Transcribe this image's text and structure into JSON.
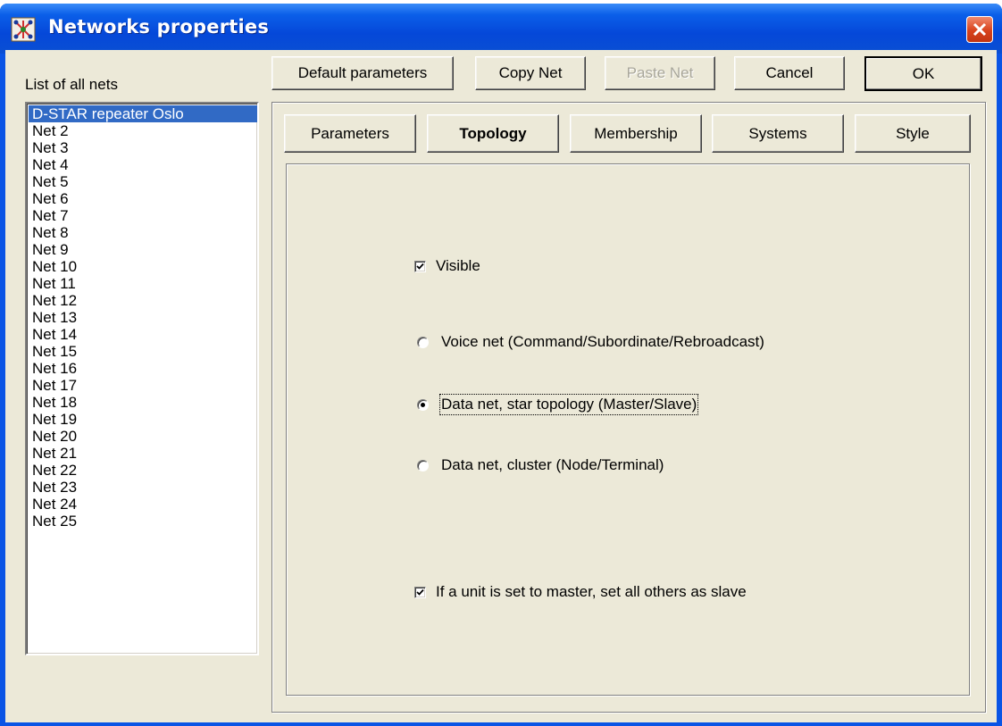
{
  "window": {
    "title": "Networks properties"
  },
  "list": {
    "label": "List of all nets",
    "items": [
      "D-STAR repeater Oslo",
      "Net  2",
      "Net  3",
      "Net  4",
      "Net  5",
      "Net  6",
      "Net  7",
      "Net  8",
      "Net  9",
      "Net 10",
      "Net 11",
      "Net 12",
      "Net 13",
      "Net 14",
      "Net 15",
      "Net 16",
      "Net 17",
      "Net 18",
      "Net 19",
      "Net 20",
      "Net 21",
      "Net 22",
      "Net 23",
      "Net 24",
      "Net 25"
    ],
    "selected": "D-STAR repeater Oslo"
  },
  "toolbar": {
    "default_params": "Default parameters",
    "copy_net": "Copy Net",
    "paste_net": "Paste Net",
    "cancel": "Cancel",
    "ok": "OK"
  },
  "tabs": {
    "parameters": "Parameters",
    "topology": "Topology",
    "membership": "Membership",
    "systems": "Systems",
    "style": "Style",
    "active": "Topology"
  },
  "topology": {
    "visible": {
      "label": "Visible",
      "checked": true
    },
    "voice_net": {
      "label": "Voice net (Command/Subordinate/Rebroadcast)",
      "selected": false
    },
    "data_star": {
      "label": "Data net, star topology (Master/Slave)",
      "selected": true
    },
    "data_cluster": {
      "label": "Data net, cluster (Node/Terminal)",
      "selected": false
    },
    "master_slave": {
      "label": "If a unit is set to master, set all others as slave",
      "checked": true
    }
  },
  "colors": {
    "titlebar": "#0a54e5",
    "face": "#ece9d8",
    "selection": "#316ac5",
    "close": "#d8421c"
  }
}
